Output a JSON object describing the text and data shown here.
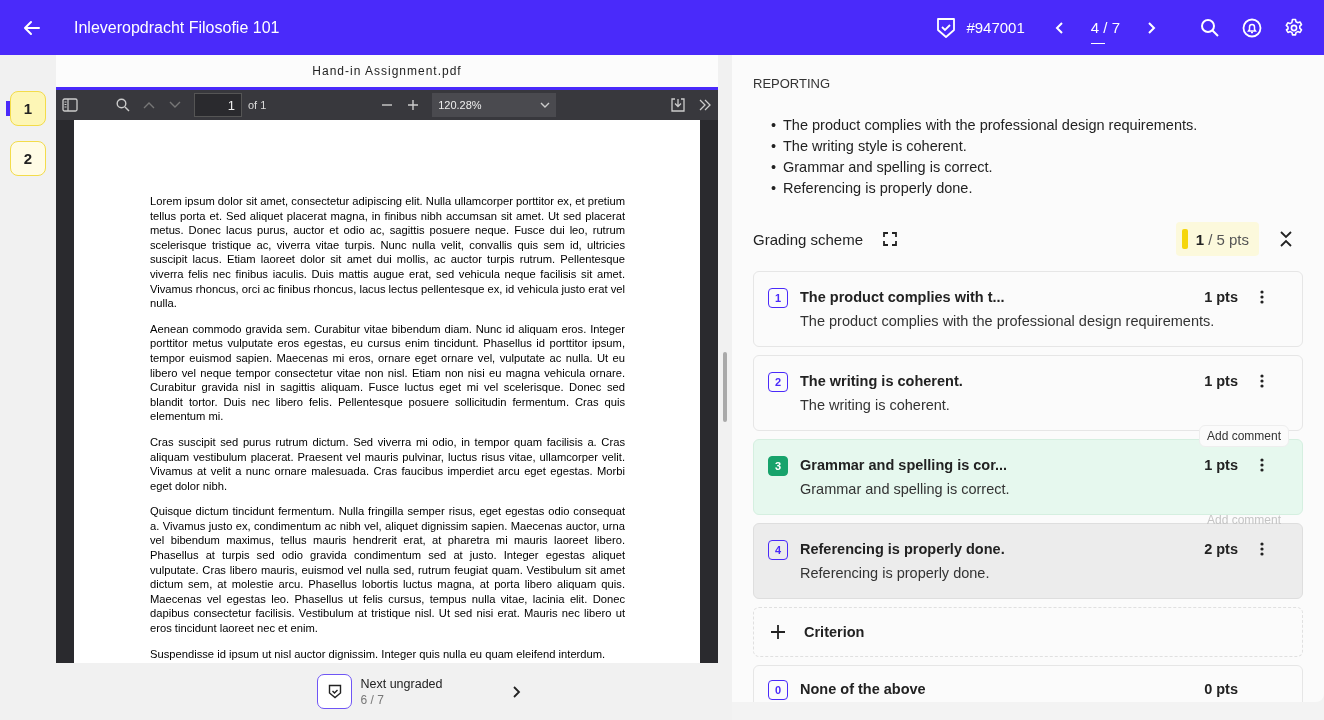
{
  "header": {
    "title": "Inleveropdracht Filosofie 101",
    "submission_id": "#947001",
    "position": "4 / 7"
  },
  "page_tabs": [
    {
      "label": "1",
      "selected": true
    },
    {
      "label": "2",
      "selected": false
    }
  ],
  "pdf": {
    "filename": "Hand-in Assignment.pdf",
    "page_input": "1",
    "page_count": "of 1",
    "zoom": "120.28%",
    "paragraphs": [
      "Lorem ipsum dolor sit amet, consectetur adipiscing elit. Nulla ullamcorper porttitor ex, et pretium tellus porta et. Sed aliquet placerat magna, in finibus nibh accumsan sit amet. Ut sed placerat metus. Donec lacus purus, auctor et odio ac, sagittis posuere neque. Fusce dui leo, rutrum scelerisque tristique ac, viverra vitae turpis. Nunc nulla velit, convallis quis sem id, ultricies suscipit lacus. Etiam laoreet dolor sit amet dui mollis, ac auctor turpis rutrum. Pellentesque viverra felis nec finibus iaculis. Duis mattis augue erat, sed vehicula neque facilisis sit amet. Vivamus rhoncus, orci ac finibus rhoncus, lacus lectus pellentesque ex, id vehicula justo erat vel nulla.",
      "Aenean commodo gravida sem. Curabitur vitae bibendum diam. Nunc id aliquam eros. Integer porttitor metus vulputate eros egestas, eu cursus enim tincidunt. Phasellus id porttitor ipsum, tempor euismod sapien. Maecenas mi eros, ornare eget ornare vel, vulputate ac nulla. Ut eu libero vel neque tempor consectetur vitae non nisl. Etiam non nisi eu magna vehicula ornare. Curabitur gravida nisl in sagittis aliquam. Fusce luctus eget mi vel scelerisque. Donec sed blandit tortor. Duis nec libero felis. Pellentesque posuere sollicitudin fermentum. Cras quis elementum mi.",
      "Cras suscipit sed purus rutrum dictum. Sed viverra mi odio, in tempor quam facilisis a. Cras aliquam vestibulum placerat. Praesent vel mauris pulvinar, luctus risus vitae, ullamcorper velit. Vivamus at velit a nunc ornare malesuada. Cras faucibus imperdiet arcu eget egestas. Morbi eget dolor nibh.",
      "Quisque dictum tincidunt fermentum. Nulla fringilla semper risus, eget egestas odio consequat a. Vivamus justo ex, condimentum ac nibh vel, aliquet dignissim sapien. Maecenas auctor, urna vel bibendum maximus, tellus mauris hendrerit erat, at pharetra mi mauris laoreet libero. Phasellus at turpis sed odio gravida condimentum sed at justo. Integer egestas aliquet vulputate. Cras libero mauris, euismod vel nulla sed, rutrum feugiat quam. Vestibulum sit amet dictum sem, at molestie arcu. Phasellus lobortis luctus magna, at porta libero aliquam quis. Maecenas vel egestas leo. Phasellus ut felis cursus, tempus nulla vitae, lacinia elit. Donec dapibus consectetur facilisis. Vestibulum at tristique nisl. Ut sed nisi erat. Mauris nec libero ut eros tincidunt laoreet nec et enim.",
      "Suspendisse id ipsum ut nisl auctor dignissim. Integer quis nulla eu quam eleifend interdum."
    ]
  },
  "next_ungraded": {
    "label": "Next ungraded",
    "count": "6 / 7"
  },
  "reporting": {
    "heading": "REPORTING",
    "bullets": [
      {
        "marker": "•",
        "text": "The product complies with the professional design requirements."
      },
      {
        "marker": "•",
        "text": "The writing style is coherent."
      },
      {
        "marker": "•",
        "text": "Grammar and spelling is correct."
      },
      {
        "marker": "•",
        "text": "Referencing is properly done."
      }
    ]
  },
  "grading": {
    "title": "Grading scheme",
    "score": "1",
    "total": "/ 5 pts",
    "criteria": [
      {
        "kind": "criterion",
        "number": "1",
        "title": "The product complies with t...",
        "description": "The product complies with the professional design requirements.",
        "points": "1 pts",
        "selected": false,
        "hovered": false
      },
      {
        "kind": "criterion",
        "number": "2",
        "title": "The writing is coherent.",
        "description": "The writing is coherent.",
        "points": "1 pts",
        "selected": false,
        "hovered": false
      },
      {
        "kind": "criterion",
        "number": "3",
        "title": "Grammar and spelling is cor...",
        "description": "Grammar and spelling is correct.",
        "points": "1 pts",
        "selected": true,
        "hovered": false,
        "hint": {
          "text": "Add comment",
          "faded": false
        }
      },
      {
        "kind": "criterion",
        "number": "4",
        "title": "Referencing is properly done.",
        "description": "Referencing is properly done.",
        "points": "2 pts",
        "selected": false,
        "hovered": true,
        "hint": {
          "text": "Add comment",
          "faded": true
        }
      },
      {
        "kind": "add",
        "label": "Criterion"
      },
      {
        "kind": "none",
        "number": "0",
        "title": "None of the above",
        "points": "0 pts"
      }
    ]
  }
}
